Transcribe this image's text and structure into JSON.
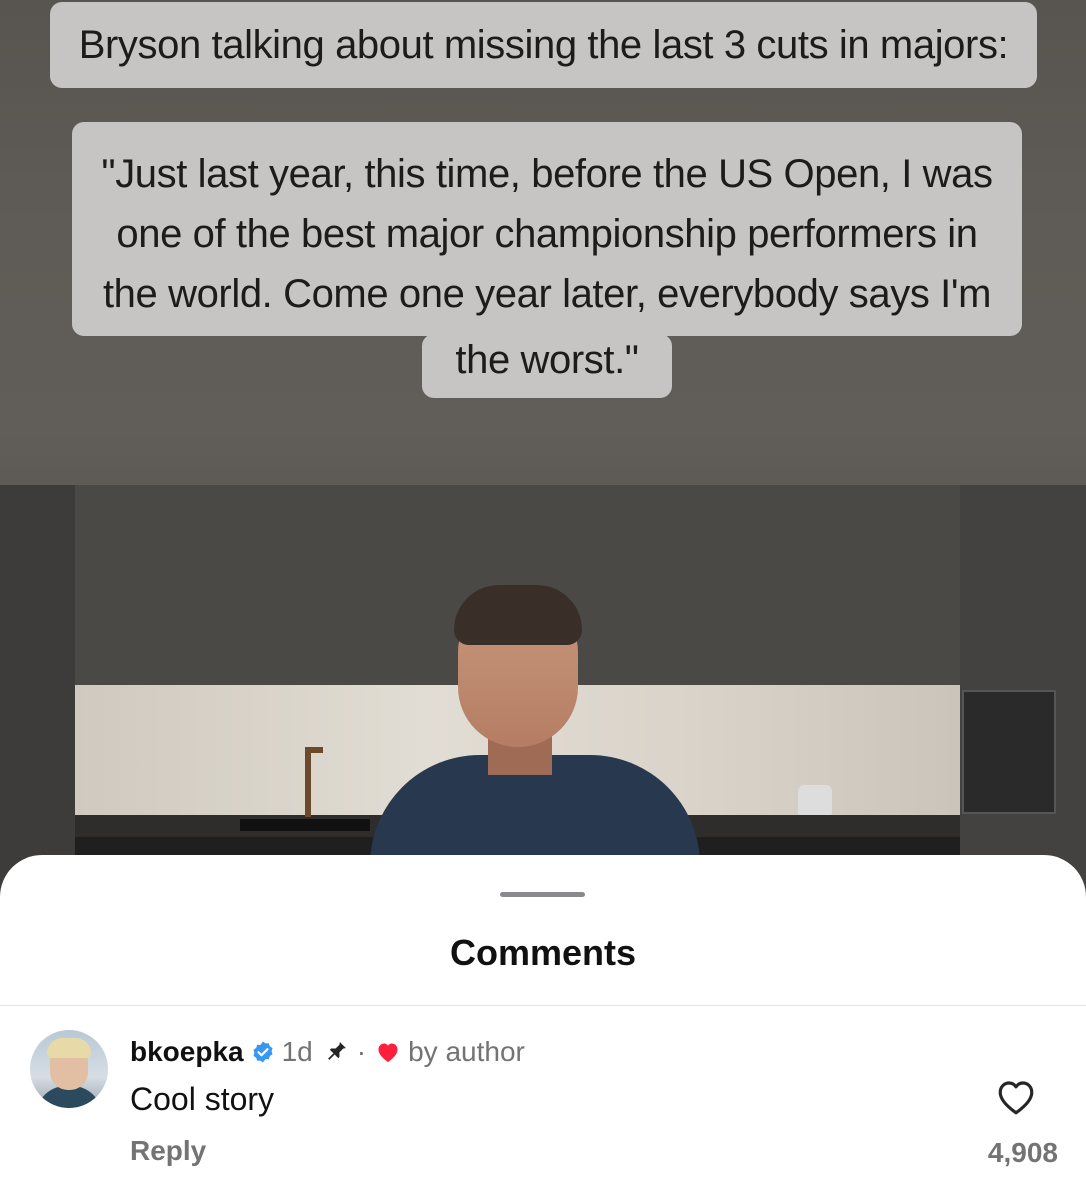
{
  "video": {
    "caption_title": "Bryson talking about missing the last 3 cuts in majors:",
    "quote_lines": [
      "\"Just last year, this time, before the US Open, I was",
      "one of the best major championship performers in",
      "the world. Come one year later, everybody says I'm",
      "the worst.\""
    ]
  },
  "comments_sheet": {
    "title": "Comments",
    "comment": {
      "username": "bkoepka",
      "time": "1d",
      "separator": "·",
      "liked_by": "by author",
      "text": "Cool story",
      "reply_label": "Reply",
      "like_count": "4,908"
    }
  },
  "colors": {
    "verified": "#3897f0",
    "heart": "#ff1f3d",
    "secondary_text": "#737373"
  },
  "icons": [
    "verified-badge-icon",
    "pin-icon",
    "heart-filled-icon",
    "heart-outline-icon"
  ]
}
